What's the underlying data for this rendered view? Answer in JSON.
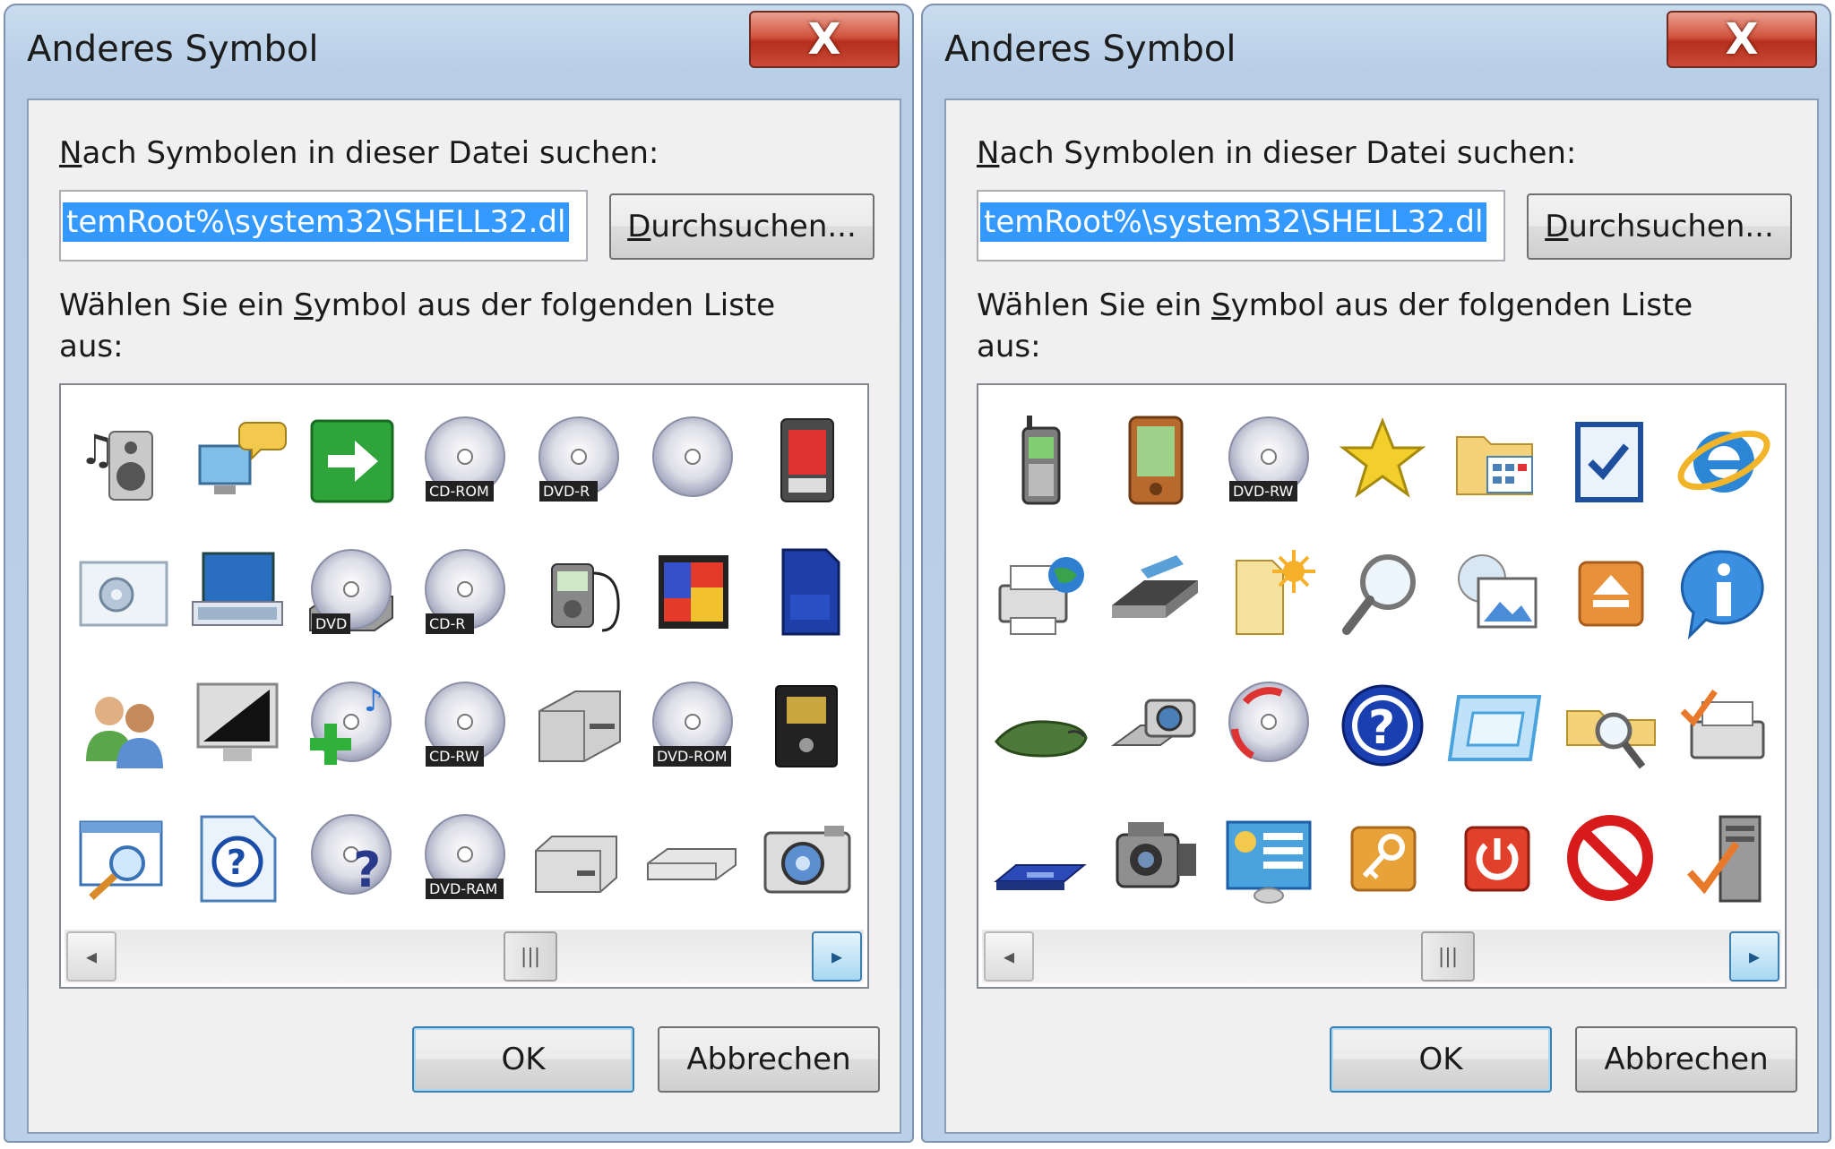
{
  "dialogs": [
    {
      "title": "Anderes Symbol",
      "close_glyph": "X",
      "file_label_mnemonic": "N",
      "file_label_rest": "ach Symbolen in dieser Datei suchen:",
      "path_value": "temRoot%\\system32\\SHELL32.dl",
      "browse_mnemonic": "D",
      "browse_rest": "urchsuchen...",
      "list_label_pre": "Wählen Sie ein ",
      "list_label_mnemonic": "S",
      "list_label_post": "ymbol aus der folgenden Liste",
      "list_label_line2": "aus:",
      "ok_label": "OK",
      "cancel_label": "Abbrechen",
      "scroll_left": "◂",
      "scroll_right": "▸",
      "scroll_thumb": "|||",
      "icons": [
        {
          "name": "music-speaker-icon"
        },
        {
          "name": "network-chat-icon"
        },
        {
          "name": "green-arrow-icon"
        },
        {
          "name": "cd-rom-icon",
          "label": "CD-ROM"
        },
        {
          "name": "dvd-r-icon",
          "label": "DVD-R"
        },
        {
          "name": "blank-cd-icon"
        },
        {
          "name": "memory-card-icon"
        },
        {
          "name": "settings-window-icon"
        },
        {
          "name": "keyboard-monitor-icon"
        },
        {
          "name": "dvd-drive-icon",
          "label": "DVD"
        },
        {
          "name": "cd-r-icon",
          "label": "CD-R"
        },
        {
          "name": "media-player-icon"
        },
        {
          "name": "compactflash-icon"
        },
        {
          "name": "sd-card-icon"
        },
        {
          "name": "users-icon"
        },
        {
          "name": "monitor-icon"
        },
        {
          "name": "cd-add-music-icon"
        },
        {
          "name": "cd-rw-icon",
          "label": "CD-RW"
        },
        {
          "name": "hard-drive-icon"
        },
        {
          "name": "dvd-rom-icon",
          "label": "DVD-ROM"
        },
        {
          "name": "smart-card-icon"
        },
        {
          "name": "search-window-icon"
        },
        {
          "name": "help-file-icon"
        },
        {
          "name": "disc-question-icon"
        },
        {
          "name": "dvd-ram-icon",
          "label": "DVD-RAM"
        },
        {
          "name": "external-drive-icon"
        },
        {
          "name": "flat-drive-icon"
        },
        {
          "name": "camera-icon"
        }
      ]
    },
    {
      "title": "Anderes Symbol",
      "close_glyph": "X",
      "file_label_mnemonic": "N",
      "file_label_rest": "ach Symbolen in dieser Datei suchen:",
      "path_value": "temRoot%\\system32\\SHELL32.dl",
      "browse_mnemonic": "D",
      "browse_rest": "urchsuchen...",
      "list_label_pre": "Wählen Sie ein ",
      "list_label_mnemonic": "S",
      "list_label_post": "ymbol aus der folgenden Liste",
      "list_label_line2": "aus:",
      "ok_label": "OK",
      "cancel_label": "Abbrechen",
      "scroll_left": "◂",
      "scroll_right": "▸",
      "scroll_thumb": "|||",
      "icons": [
        {
          "name": "mobile-phone-icon"
        },
        {
          "name": "pda-icon"
        },
        {
          "name": "dvd-rw-icon",
          "label": "DVD-RW"
        },
        {
          "name": "star-icon"
        },
        {
          "name": "folder-grid-icon"
        },
        {
          "name": "checklist-icon"
        },
        {
          "name": "internet-explorer-icon"
        },
        {
          "name": "network-printer-icon"
        },
        {
          "name": "scanner-icon"
        },
        {
          "name": "new-folder-icon"
        },
        {
          "name": "magnifier-icon"
        },
        {
          "name": "pictures-icon"
        },
        {
          "name": "eject-icon"
        },
        {
          "name": "info-icon"
        },
        {
          "name": "mouse-icon"
        },
        {
          "name": "scanner-camera-icon"
        },
        {
          "name": "disc-refresh-icon"
        },
        {
          "name": "help-icon"
        },
        {
          "name": "window-frame-icon"
        },
        {
          "name": "folder-search-icon"
        },
        {
          "name": "printer-check-icon"
        },
        {
          "name": "floppy-drive-icon"
        },
        {
          "name": "camcorder-icon"
        },
        {
          "name": "network-settings-icon"
        },
        {
          "name": "key-icon"
        },
        {
          "name": "power-icon"
        },
        {
          "name": "no-entry-icon"
        },
        {
          "name": "server-check-icon"
        }
      ]
    }
  ],
  "colors": {
    "selection": "#3399ff",
    "close_button": "#c94a36",
    "frame": "#bcd1e8",
    "client": "#f0f0f0"
  }
}
